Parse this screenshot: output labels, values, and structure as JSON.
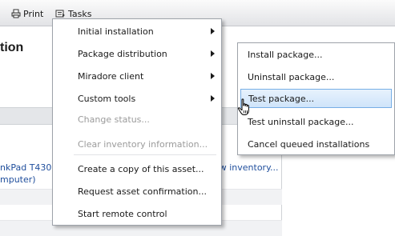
{
  "toolbar": {
    "print_label": "Print",
    "tasks_label": "Tasks"
  },
  "page": {
    "title_fragment": "tion",
    "asset_model_fragment": "nkPad T430 2",
    "asset_type_fragment": "mputer)",
    "inventory_link_fragment": "ow inventory..."
  },
  "menu": {
    "items": [
      {
        "label": "Initial installation",
        "submenu": true,
        "enabled": true
      },
      {
        "label": "Package distribution",
        "submenu": true,
        "enabled": true
      },
      {
        "label": "Miradore client",
        "submenu": true,
        "enabled": true
      },
      {
        "label": "Custom tools",
        "submenu": true,
        "enabled": true
      },
      {
        "label": "Change status...",
        "submenu": false,
        "enabled": false
      },
      {
        "label": "Clear inventory information...",
        "submenu": false,
        "enabled": false
      },
      {
        "label": "Create a copy of this asset...",
        "submenu": false,
        "enabled": true
      },
      {
        "label": "Request asset confirmation...",
        "submenu": false,
        "enabled": true
      },
      {
        "label": "Start remote control",
        "submenu": false,
        "enabled": true
      }
    ]
  },
  "submenu": {
    "items": [
      {
        "label": "Install package..."
      },
      {
        "label": "Uninstall package..."
      },
      {
        "label": "Test package...",
        "highlighted": true
      },
      {
        "label": "Test uninstall package..."
      },
      {
        "label": "Cancel queued installations"
      }
    ]
  },
  "colors": {
    "link": "#1f4e9c",
    "highlight_border": "#77aee6",
    "highlight_fill": "#cfe4fa",
    "disabled_text": "#9b9b9b"
  }
}
